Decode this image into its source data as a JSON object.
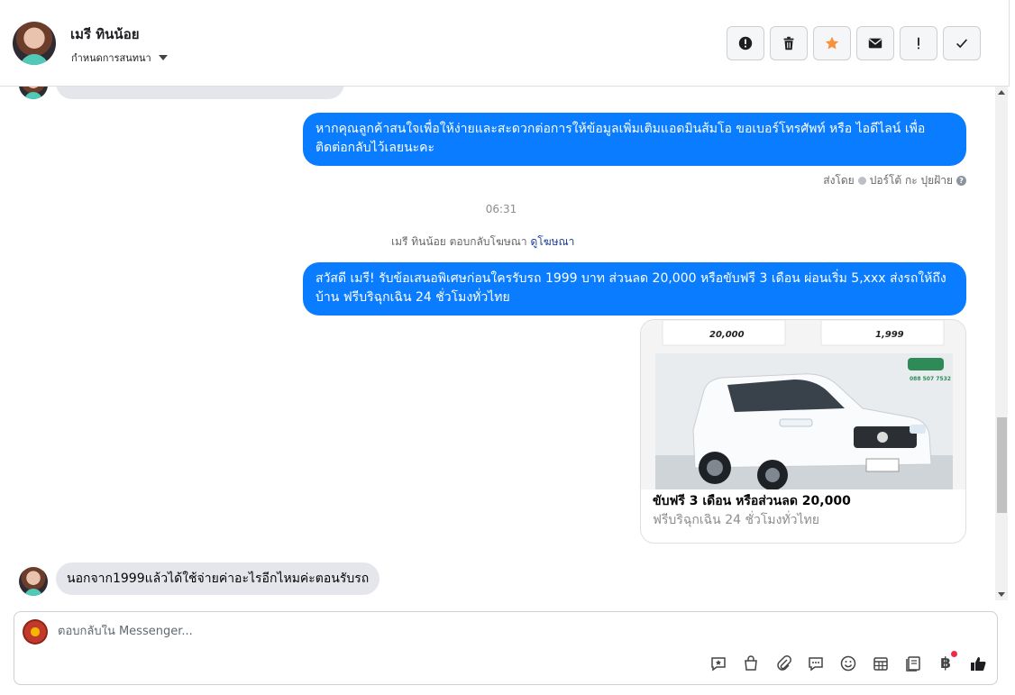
{
  "header": {
    "contact_name": "เมรี ทินน้อย",
    "assign_label": "กำหนดการสนทนา",
    "actions": [
      {
        "name": "report-button",
        "icon": "alert-circle-icon"
      },
      {
        "name": "delete-button",
        "icon": "trash-icon"
      },
      {
        "name": "star-button",
        "icon": "star-icon",
        "color": "#f7923b"
      },
      {
        "name": "mark-unread-button",
        "icon": "envelope-icon"
      },
      {
        "name": "follow-up-button",
        "icon": "exclamation-icon"
      },
      {
        "name": "mark-done-button",
        "icon": "check-icon"
      }
    ]
  },
  "messages": {
    "out_1": "หากคุณลูกค้าสนใจเพื่อให้ง่ายและสะดวกต่อการให้ข้อมูลเพิ่มเติมแอดมินส้มโอ ขอเบอร์โทรศัพท์ หรือ ไอดีไลน์ เพื่อติดต่อกลับไว้เลยนะคะ",
    "sent_by_label": "ส่งโดย",
    "sent_by_name": "ปอร์โต้ กะ ปุยฝ้าย",
    "time": "06:31",
    "ad_reply_text": "เมรี ทินน้อย ตอบกลับโฆษณา",
    "ad_link": "ดูโฆษณา",
    "out_2": "สวัสดี เมรี! รับข้อเสนอพิเศษก่อนใครรับรถ 1999 บาท ส่วนลด 20,000 หรือขับฟรี 3 เดือน ผ่อนเริ่ม 5,xxx ส่งรถให้ถึงบ้าน ฟรีบริฉุกเฉิน 24 ชั่วโมงทั่วไทย",
    "card": {
      "title": "ขับฟรี 3 เดือน หรือส่วนลด 20,000",
      "subtitle": "ฟรีบริฉุกเฉิน 24 ชั่วโมงทั่วไทย",
      "img_price_1": "20,000",
      "img_price_2": "1,999",
      "img_phone": "088 507 7532"
    },
    "in_last": "นอกจาก1999แล้วได้ใช้จ่ายค่าอะไรอีกไหมค่ะตอนรับรถ"
  },
  "composer": {
    "placeholder": "ตอบกลับใน Messenger...",
    "tools": [
      "saved-reply-icon",
      "shop-icon",
      "attachment-icon",
      "chat-bubbles-icon",
      "emoji-icon",
      "calendar-icon",
      "catalog-icon",
      "payment-icon",
      "like-icon"
    ],
    "currency_symbol": "฿"
  },
  "colors": {
    "outgoing_bubble": "#0a7cff",
    "incoming_bubble": "#e4e6eb",
    "star_accent": "#f7923b",
    "notification_dot": "#f02849"
  }
}
